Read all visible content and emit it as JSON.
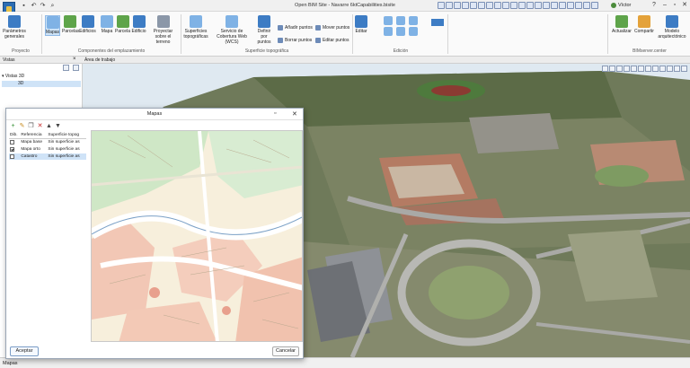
{
  "app": {
    "title": "Open BIM Site - Navarre 6ktCapabilities.bisite",
    "user": "Víctor",
    "colors": {
      "accent": "#2c6db3",
      "selection": "#cde3f7"
    }
  },
  "ribbon": {
    "buttons": {
      "project_params": "Parámetros generales",
      "maps": "Mapas",
      "parcels": "Parcelas",
      "buildings": "Edificios",
      "map": "Mapa",
      "parcel": "Parcela",
      "building": "Edificio",
      "project_on_terrain": "Proyectar sobre el terreno",
      "topo_surfaces": "Superficies topográficas",
      "coverage_service": "Servicio de Cobertura Web (WCS)",
      "define_by_points": "Definir por puntos",
      "add_points": "Añadir puntos",
      "move_points": "Mover puntos",
      "delete_points": "Borrar puntos",
      "edit_points": "Editar puntos",
      "edit": "Editar",
      "update": "Actualizar",
      "share": "Compartir",
      "arch_model": "Modelo arquitectónico"
    },
    "groups": {
      "project": "Proyecto",
      "site_components": "Componentes del emplazamiento",
      "topographic_surface": "Superficie topográfica",
      "editing": "Edición",
      "bimserver": "BIMserver.center"
    }
  },
  "panels": {
    "views_title": "Vistas",
    "work_area_title": "Área de trabajo",
    "tree_root": "Vistas 3D",
    "tree_item": "3D"
  },
  "dialog": {
    "title": "Mapas",
    "columns": [
      "Dib.",
      "Referencia",
      "Superficie topog"
    ],
    "rows": [
      {
        "draw": false,
        "ref": "Mapa base",
        "surface": "Sin superficie as"
      },
      {
        "draw": true,
        "ref": "Mapa orto",
        "surface": "Sin superficie as"
      },
      {
        "draw": false,
        "ref": "Catastro",
        "surface": "Sin superficie as"
      }
    ],
    "accept": "Aceptar",
    "cancel": "Cancelar"
  },
  "status": {
    "text": "Mapas"
  }
}
